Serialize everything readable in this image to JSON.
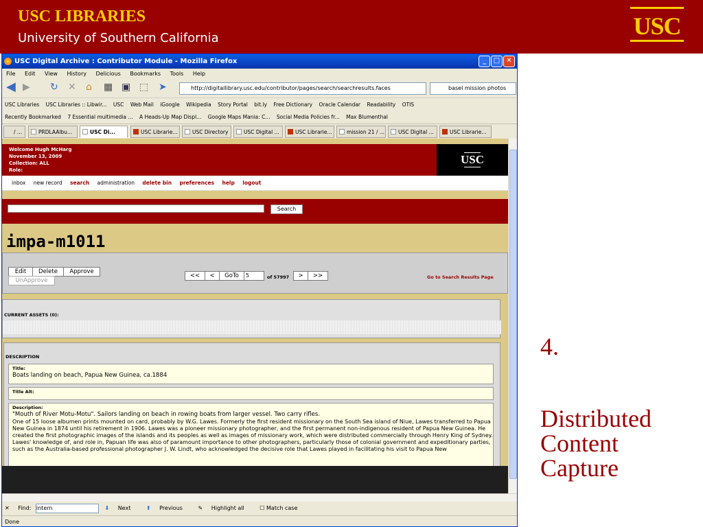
{
  "slide": {
    "banner_title": "USC LIBRARIES",
    "banner_subtitle": "University of Southern California",
    "logo": "USC",
    "number": "4.",
    "heading": "Distributed\nContent\nCapture",
    "colors": {
      "cardinal": "#990000",
      "gold": "#ffcc00"
    }
  },
  "browser": {
    "window_title": "USC Digital Archive : Contributor Module - Mozilla Firefox",
    "menu": [
      "File",
      "Edit",
      "View",
      "History",
      "Delicious",
      "Bookmarks",
      "Tools",
      "Help"
    ],
    "url": "http://digitallibrary.usc.edu/contributor/pages/search/searchresults.faces",
    "search_value": "basel mission photos",
    "bookmarks": [
      "USC Libraries",
      "USC Libraries :: Libwir...",
      "USC",
      "Web Mail",
      "iGoogle",
      "Wikipedia",
      "Story Portal",
      "bit.ly",
      "Free Dictionary",
      "Oracle Calendar",
      "Readability",
      "OTIS"
    ],
    "bookmarks2": [
      "Recently Bookmarked",
      "7 Essential multimedia ...",
      "A Heads-Up Map Displ...",
      "Google Maps Mania: C...",
      "Social Media Policies fr...",
      "Max Blumenthal"
    ],
    "tabs": [
      "/ ...",
      "PRDLAAlbu...",
      "USC Di...",
      "USC Librarie...",
      "USC Directory",
      "USC Digital ...",
      "USC Librarie...",
      "mission 21 / ...",
      "USC Digital ...",
      "USC Librarie..."
    ],
    "find_label": "Find:",
    "find_value": "intern",
    "find_next": "Next",
    "find_prev": "Previous",
    "find_highlight": "Highlight all",
    "find_matchcase": "Match case",
    "status": "Done"
  },
  "page": {
    "welcome": "Welcome Hugh McHarg",
    "date": "November 13, 2009",
    "collection": "Collection: ALL",
    "role": "Role:",
    "logo": "USC",
    "nav": [
      "inbox",
      "new record",
      "search",
      "administration",
      "delete bin",
      "preferences",
      "help",
      "logout"
    ],
    "search_button": "Search",
    "record_id": "impa-m1011",
    "actions": {
      "edit": "Edit",
      "delete": "Delete",
      "approve": "Approve",
      "unapprove": "UnApprove"
    },
    "pager": {
      "first": "<<",
      "prev": "<",
      "goto": "GoTo",
      "goto_value": "5",
      "of": "of 57997",
      "next": ">",
      "last": ">>"
    },
    "goto_results": "Go to Search Results Page",
    "assets_label": "CURRENT ASSETS (0):",
    "description_label": "DESCRIPTION",
    "title_label": "Title:",
    "title_value": "Boats landing on beach, Papua New Guinea, ca.1884",
    "title_alt_label": "Title Alt:",
    "desc_label": "Description:",
    "desc_value": "\"Mouth of River Motu-Motu\". Sailors landing on beach in rowing boats from larger vessel. Two carry rifles.",
    "desc_value2": "One of 15 loose albumen prints mounted on card, probably by W.G. Lawes. Formerly the first resident missionary on the South Sea island of Niue, Lawes transferred to Papua New Guinea in 1874 until his retirement in 1906. Lawes was a pioneer missionary photographer, and the first permanent non-indigenous resident of Papua New Guinea. He created the first photographic images of the islands and its peoples as well as images of missionary work, which were distributed commercially through Henry King of Sydney. Lawes' knowledge of, and role in, Papuan life was also of paramount importance to other photographers, particularly those of colonial government and expeditionary parties, such as the Australia-based professional photographer J. W. Lindt, who acknowledged the decisive role that Lawes played in facilitating his visit to Papua New"
  }
}
